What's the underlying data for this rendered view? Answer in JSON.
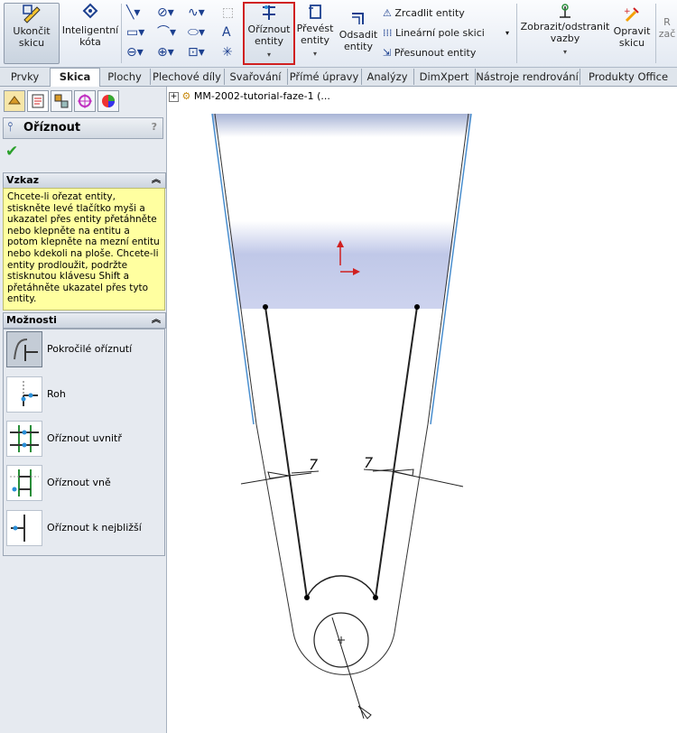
{
  "ribbon": {
    "exit_sketch": "Ukončit skicu",
    "smart_dim": "Inteligentní kóta",
    "trim": "Oříznout entity",
    "convert": "Převést entity",
    "offset": "Odsadit entity",
    "mirror": "Zrcadlit entity",
    "linear_pattern": "Lineární pole skici",
    "move": "Přesunout entity",
    "display_relations": "Zobrazit/odstranit vazby",
    "repair": "Opravit skicu",
    "cut_off": "R zač"
  },
  "tabs": [
    "Prvky",
    "Skica",
    "Plochy",
    "Plechové díly",
    "Svařování",
    "Přímé úpravy",
    "Analýzy",
    "DimXpert",
    "Nástroje rendrování",
    "Produkty Office"
  ],
  "active_tab": "Skica",
  "panel": {
    "title": "Oříznout",
    "help": "?",
    "message_header": "Vzkaz",
    "message": "Chcete-li ořezat entity, stiskněte levé tlačítko myši a ukazatel přes entity přetáhněte nebo klepněte na entitu a potom klepněte na mezní entitu nebo kdekoli na ploše. Chcete-li entity prodloužit, podržte stisknutou klávesu Shift a přetáhněte ukazatel přes tyto entity.",
    "options_header": "Možnosti",
    "options": [
      "Pokročilé oříznutí",
      "Roh",
      "Oříznout uvnitř",
      "Oříznout vně",
      "Oříznout k nejbližší"
    ]
  },
  "tree": {
    "label": "MM-2002-tutorial-faze-1  (..."
  },
  "dimensions": {
    "left": "7",
    "right": "7"
  },
  "colors": {
    "accent_red": "#d02020",
    "message_bg": "#ffffa0"
  }
}
